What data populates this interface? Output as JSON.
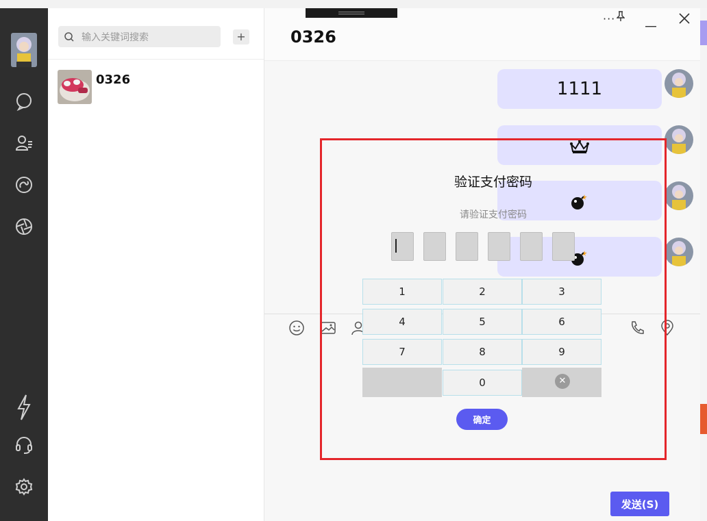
{
  "window": {
    "title": "0326"
  },
  "search": {
    "placeholder": "输入关键词搜索",
    "add_label": "+"
  },
  "conversations": [
    {
      "name": "0326"
    }
  ],
  "chat": {
    "title": "0326",
    "messages": [
      {
        "type": "text",
        "content": "1111"
      },
      {
        "type": "emoji",
        "icon": "crown-icon"
      },
      {
        "type": "emoji",
        "icon": "bomb-icon"
      },
      {
        "type": "emoji",
        "icon": "bomb-icon"
      }
    ],
    "send_label": "发送(S)"
  },
  "dialog": {
    "title": "验证支付密码",
    "subtitle": "请验证支付密码",
    "keys": [
      "1",
      "2",
      "3",
      "4",
      "5",
      "6",
      "7",
      "8",
      "9",
      "0"
    ],
    "delete_symbol": "✕",
    "confirm_label": "确定"
  },
  "colors": {
    "accent": "#5b5bf0",
    "bubble": "#e2e1ff",
    "rail": "#2e2e2e",
    "highlight_border": "#e4262b"
  }
}
